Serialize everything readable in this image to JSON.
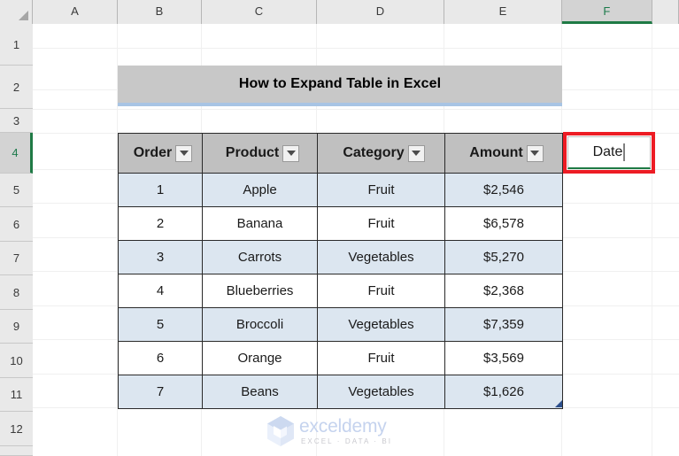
{
  "app": {
    "name": "Microsoft Excel",
    "active_cell": "F4"
  },
  "grid": {
    "column_headers": [
      {
        "label": "A",
        "active": false
      },
      {
        "label": "B",
        "active": false
      },
      {
        "label": "C",
        "active": false
      },
      {
        "label": "D",
        "active": false
      },
      {
        "label": "E",
        "active": false
      },
      {
        "label": "F",
        "active": true
      }
    ],
    "row_headers": [
      {
        "label": "1",
        "active": false
      },
      {
        "label": "2",
        "active": false
      },
      {
        "label": "3",
        "active": false
      },
      {
        "label": "4",
        "active": true
      },
      {
        "label": "5",
        "active": false
      },
      {
        "label": "6",
        "active": false
      },
      {
        "label": "7",
        "active": false
      },
      {
        "label": "8",
        "active": false
      },
      {
        "label": "9",
        "active": false
      },
      {
        "label": "10",
        "active": false
      },
      {
        "label": "11",
        "active": false
      },
      {
        "label": "12",
        "active": false
      }
    ],
    "select_all_icon": "select-all-triangle-icon"
  },
  "title_banner": {
    "text": "How to Expand Table in Excel",
    "background_color": "#c8c8c8",
    "accent_color": "#a8c4e4"
  },
  "table": {
    "header_background": "#c0c0c0",
    "band_color": "#dce6f0",
    "border_color": "#2a2a2a",
    "filter_icon": "filter-dropdown-icon",
    "columns": [
      {
        "label": "Order",
        "has_filter": true
      },
      {
        "label": "Product",
        "has_filter": true
      },
      {
        "label": "Category",
        "has_filter": true
      },
      {
        "label": "Amount",
        "has_filter": true
      }
    ],
    "rows": [
      {
        "order": "1",
        "product": "Apple",
        "category": "Fruit",
        "amount": "$2,546"
      },
      {
        "order": "2",
        "product": "Banana",
        "category": "Fruit",
        "amount": "$6,578"
      },
      {
        "order": "3",
        "product": "Carrots",
        "category": "Vegetables",
        "amount": "$5,270"
      },
      {
        "order": "4",
        "product": "Blueberries",
        "category": "Fruit",
        "amount": "$2,368"
      },
      {
        "order": "5",
        "product": "Broccoli",
        "category": "Vegetables",
        "amount": "$7,359"
      },
      {
        "order": "6",
        "product": "Orange",
        "category": "Fruit",
        "amount": "$3,569"
      },
      {
        "order": "7",
        "product": "Beans",
        "category": "Vegetables",
        "amount": "$1,626"
      }
    ],
    "resize_handle_icon": "table-resize-handle-icon"
  },
  "edit_cell": {
    "cell_reference": "F4",
    "value": "Date",
    "in_edit_mode": true
  },
  "annotation": {
    "shape": "rectangle",
    "color": "#ed1c24",
    "target_cell": "F4"
  },
  "watermark": {
    "name": "exceldemy",
    "tagline": "EXCEL  ·  DATA  ·  BI",
    "logo_icon": "exceldemy-cube-logo-icon",
    "color": "#c5d3ee"
  }
}
